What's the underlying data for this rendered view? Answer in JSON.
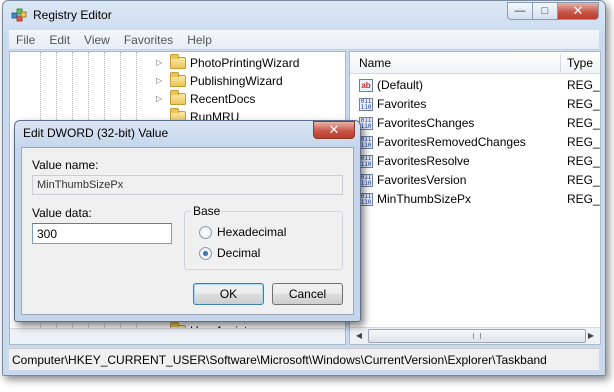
{
  "window": {
    "title": "Registry Editor",
    "caption_buttons": {
      "minimize": "—",
      "maximize": "□",
      "close": "✕"
    }
  },
  "menu": [
    "File",
    "Edit",
    "View",
    "Favorites",
    "Help"
  ],
  "tree": {
    "items": [
      {
        "label": "PhotoPrintingWizard",
        "expander": "▷"
      },
      {
        "label": "PublishingWizard",
        "expander": "▷"
      },
      {
        "label": "RecentDocs",
        "expander": "▷"
      },
      {
        "label": "RunMRU",
        "expander": ""
      },
      {
        "label": "UserAssist",
        "expander": "▷"
      }
    ]
  },
  "values_pane": {
    "columns": {
      "name": "Name",
      "type": "Type"
    },
    "rows": [
      {
        "name": "(Default)",
        "type": "REG_",
        "icon": "string-value-icon",
        "icon_text": "ab"
      },
      {
        "name": "Favorites",
        "type": "REG_",
        "icon": "binary-value-icon",
        "icon_text": "011 110"
      },
      {
        "name": "FavoritesChanges",
        "type": "REG_",
        "icon": "binary-value-icon",
        "icon_text": "011 110"
      },
      {
        "name": "FavoritesRemovedChanges",
        "type": "REG_",
        "icon": "binary-value-icon",
        "icon_text": "011 110"
      },
      {
        "name": "FavoritesResolve",
        "type": "REG_",
        "icon": "binary-value-icon",
        "icon_text": "011 110"
      },
      {
        "name": "FavoritesVersion",
        "type": "REG_",
        "icon": "binary-value-icon",
        "icon_text": "011 110"
      },
      {
        "name": "MinThumbSizePx",
        "type": "REG_",
        "icon": "binary-value-icon",
        "icon_text": "011 110"
      }
    ],
    "scroll": {
      "left_arrow": "◀",
      "right_arrow": "▶"
    }
  },
  "status_bar": {
    "path": "Computer\\HKEY_CURRENT_USER\\Software\\Microsoft\\Windows\\CurrentVersion\\Explorer\\Taskband"
  },
  "dialog": {
    "title": "Edit DWORD (32-bit) Value",
    "close": "✕",
    "value_name_label": "Value name:",
    "value_name": "MinThumbSizePx",
    "value_data_label": "Value data:",
    "value_data": "300",
    "base_label": "Base",
    "radio_hex": "Hexadecimal",
    "radio_dec": "Decimal",
    "selected_base": "Decimal",
    "ok": "OK",
    "cancel": "Cancel"
  },
  "colors": {
    "accent": "#3c7fb1",
    "close_button": "#c7584a",
    "title_gradient": "#dbe7f5"
  }
}
